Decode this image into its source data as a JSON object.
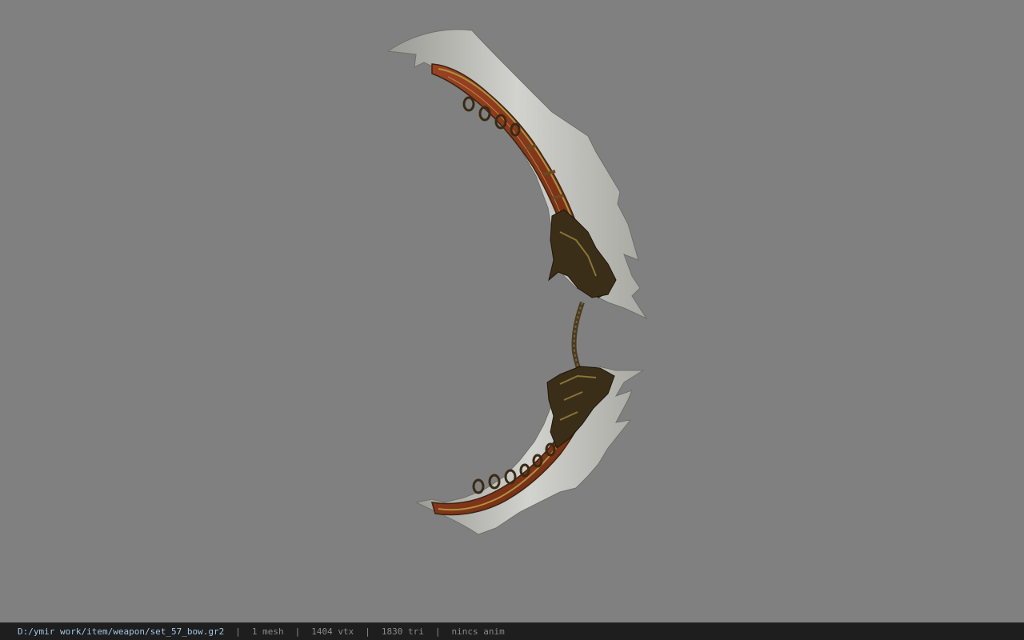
{
  "viewer": {
    "background_color": "#808080",
    "model_name": "bow-model",
    "model_colors": {
      "blade": "#c8c8c4",
      "blade_shadow": "#8e8e88",
      "wood": "#8a3a1c",
      "wood_dark": "#5a2410",
      "ornament": "#7a6430",
      "ornament_dark": "#2e2414",
      "string": "#4a3a22"
    }
  },
  "status": {
    "file_path": "D:/ymir work/item/weapon/set_57_bow.gr2",
    "separator": "|",
    "mesh_count": "1 mesh",
    "vertex_count": "1404 vtx",
    "triangle_count": "1830 tri",
    "animation": "nincs anim"
  }
}
